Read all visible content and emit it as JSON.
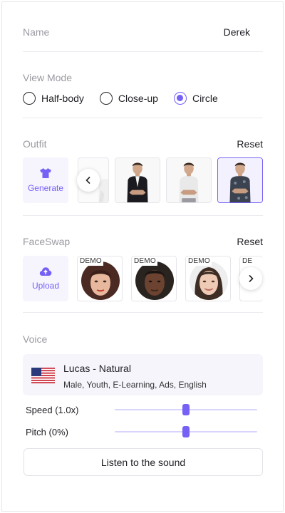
{
  "name_row": {
    "label": "Name",
    "value": "Derek"
  },
  "view_mode": {
    "label": "View Mode",
    "options": [
      {
        "label": "Half-body",
        "selected": false
      },
      {
        "label": "Close-up",
        "selected": false
      },
      {
        "label": "Circle",
        "selected": true
      }
    ]
  },
  "outfit": {
    "label": "Outfit",
    "reset_label": "Reset",
    "generate_label": "Generate",
    "selected_index": 3
  },
  "faceswap": {
    "label": "FaceSwap",
    "reset_label": "Reset",
    "upload_label": "Upload",
    "demo_badge": "DEMO",
    "partial_badge": "DE"
  },
  "voice": {
    "label": "Voice",
    "name": "Lucas - Natural",
    "tags": "Male, Youth, E-Learning, Ads, English",
    "flag_icon": "us-flag-icon",
    "speed_label": "Speed (1.0x)",
    "pitch_label": "Pitch (0%)",
    "speed_level": 0.5,
    "pitch_level": 0.5,
    "listen_label": "Listen to the sound"
  },
  "colors": {
    "accent": "#7561f5",
    "muted": "#9a9aa2",
    "card": "#f6f5fc"
  }
}
